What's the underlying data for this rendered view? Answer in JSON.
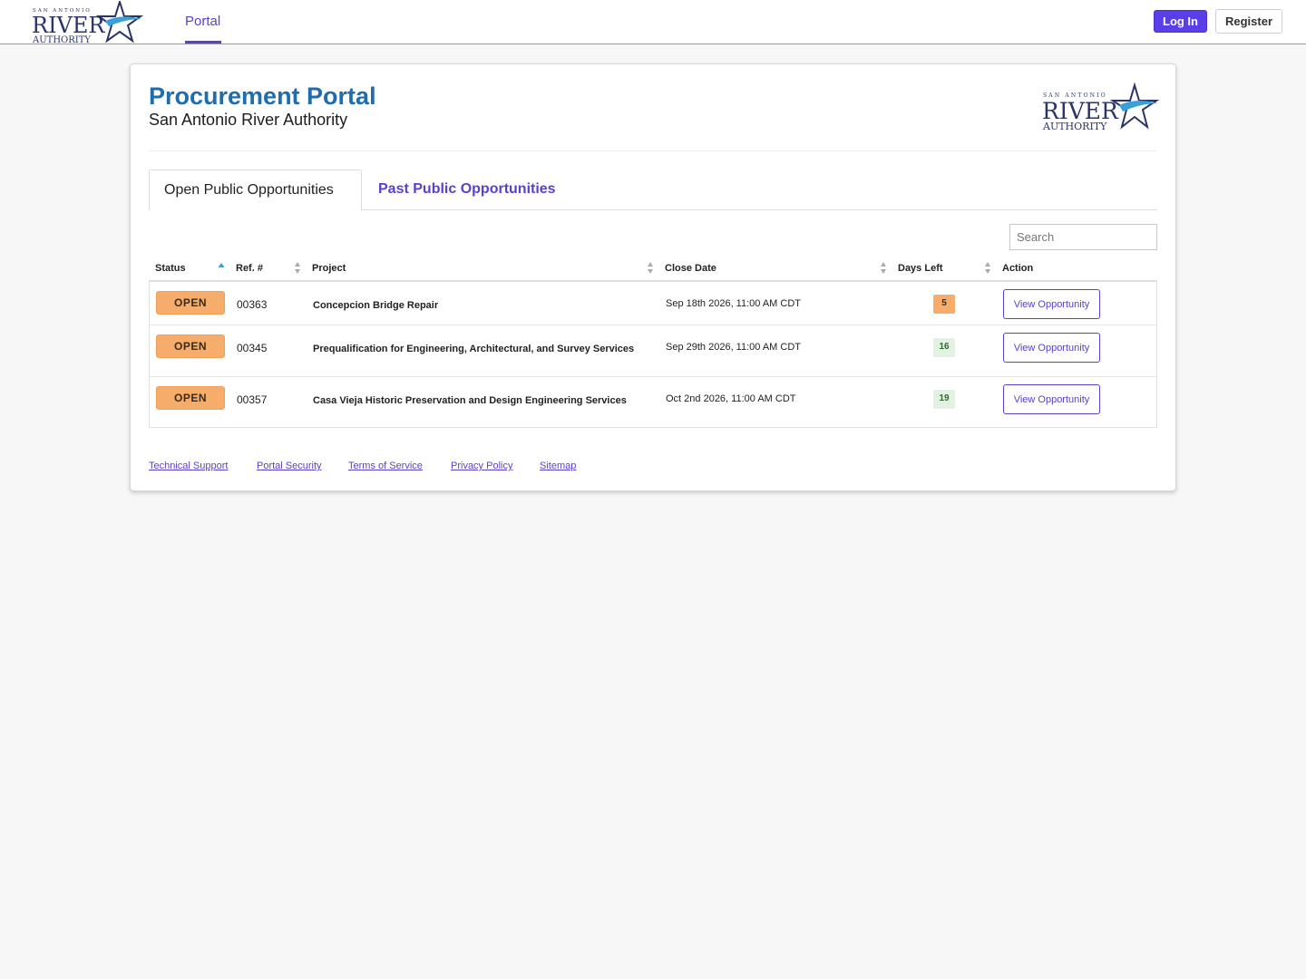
{
  "brand": {
    "logo_small": "SAN ANTONIO",
    "logo_main": "RIVER",
    "logo_sub": "AUTHORITY"
  },
  "nav": {
    "portal_tab": "Portal",
    "login_label": "Log In",
    "register_label": "Register"
  },
  "header": {
    "title": "Procurement Portal",
    "subtitle": "San Antonio River Authority"
  },
  "tabs": {
    "open_label": "Open Public Opportunities",
    "past_label": "Past Public Opportunities"
  },
  "search": {
    "placeholder": "Search"
  },
  "table": {
    "columns": {
      "status": "Status",
      "ref": "Ref. #",
      "project": "Project",
      "close_date": "Close Date",
      "days_left": "Days Left",
      "action": "Action"
    },
    "rows": [
      {
        "status": "OPEN",
        "ref": "00363",
        "project": "Concepcion Bridge Repair",
        "close_date": "Sep 18th 2026, 11:00 AM CDT",
        "days_left": "5",
        "action": "View Opportunity"
      },
      {
        "status": "OPEN",
        "ref": "00345",
        "project": "Prequalification for Engineering, Architectural, and Survey Services",
        "close_date": "Sep 29th 2026, 11:00 AM CDT",
        "days_left": "16",
        "action": "View Opportunity"
      },
      {
        "status": "OPEN",
        "ref": "00357",
        "project": "Casa Vieja Historic Preservation and Design Engineering Services",
        "close_date": "Oct 2nd 2026, 11:00 AM CDT",
        "days_left": "19",
        "action": "View Opportunity"
      }
    ]
  },
  "footer": {
    "technical_support": "Technical Support",
    "portal_security": "Portal Security",
    "terms": "Terms of Service",
    "privacy": "Privacy Policy",
    "sitemap": "Sitemap"
  },
  "colors": {
    "accent": "#5b3fd0",
    "title_blue": "#1f6cae",
    "status_orange": "#f6ad6b",
    "days_ok_bg": "#e3f1e3",
    "logo_navy": "#2b3466",
    "logo_wave": "#3aa0d8"
  },
  "icons": {
    "sort_asc": "sort-ascending-icon",
    "sort_both": "sort-icon"
  }
}
